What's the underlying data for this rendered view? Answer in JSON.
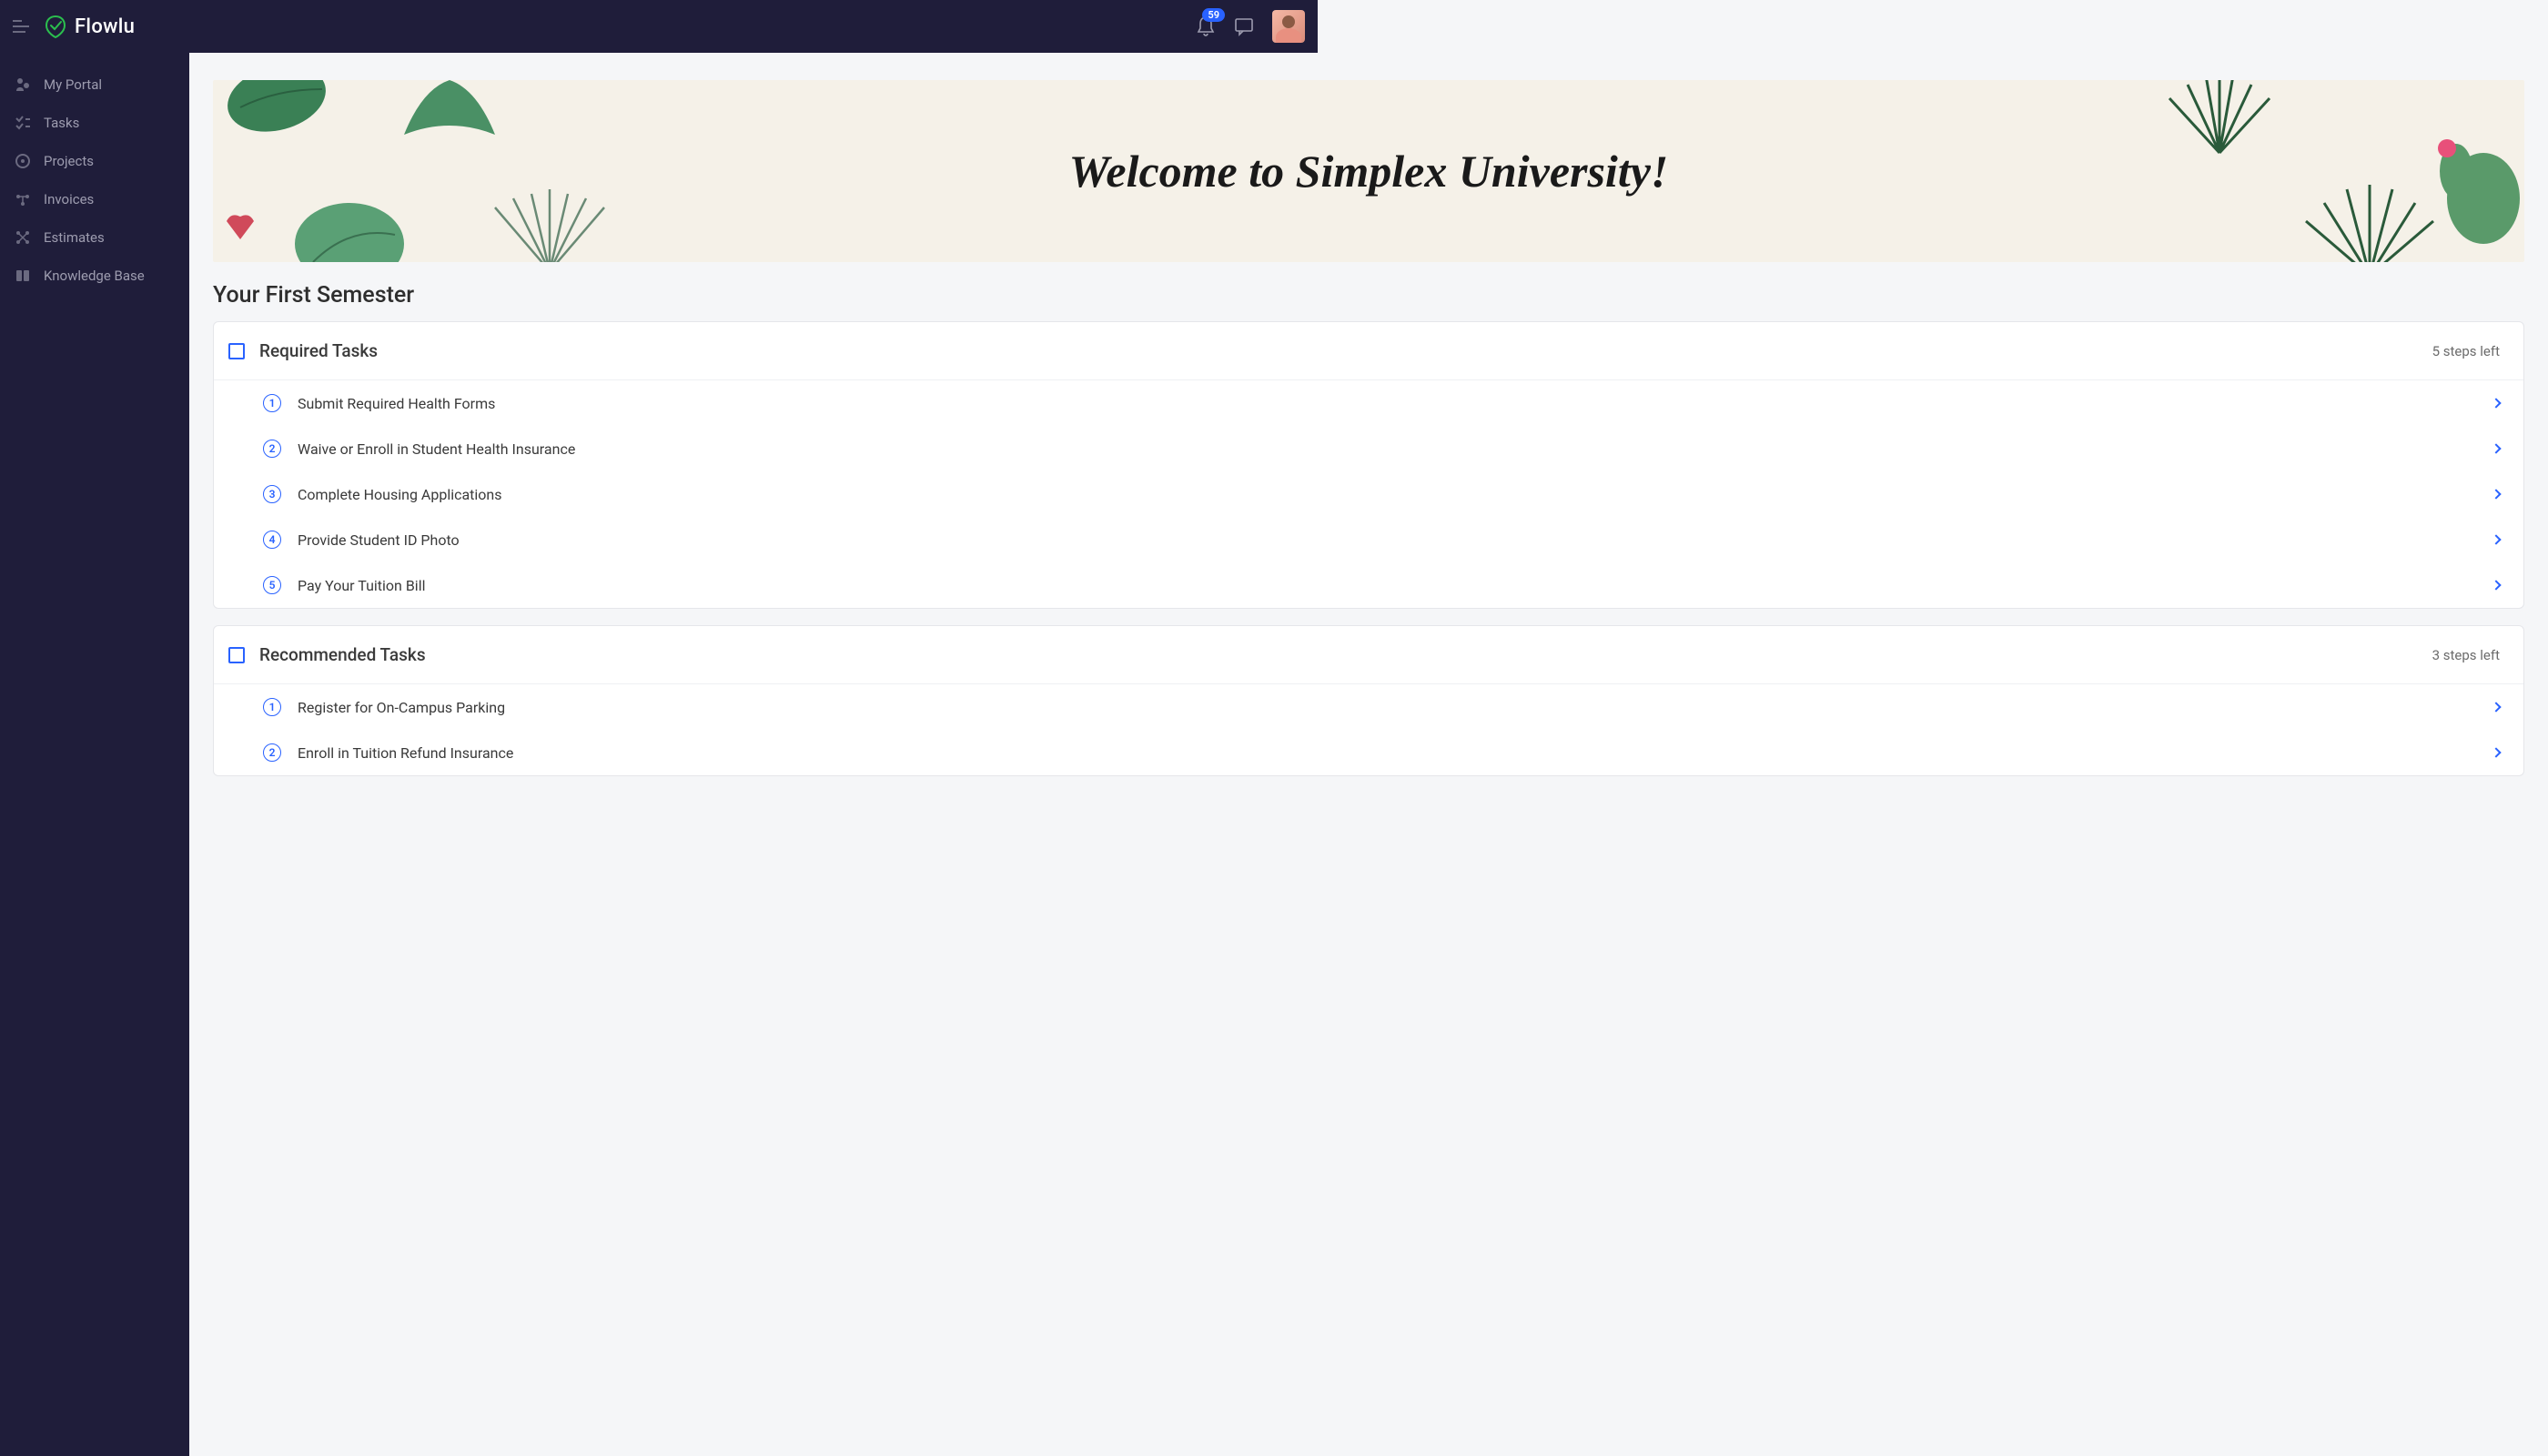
{
  "header": {
    "brand": "Flowlu",
    "notification_count": "59"
  },
  "sidebar": {
    "items": [
      {
        "label": "My Portal"
      },
      {
        "label": "Tasks"
      },
      {
        "label": "Projects"
      },
      {
        "label": "Invoices"
      },
      {
        "label": "Estimates"
      },
      {
        "label": "Knowledge Base"
      }
    ]
  },
  "banner": {
    "title": "Welcome to Simplex University!"
  },
  "section": {
    "title": "Your First Semester"
  },
  "cards": [
    {
      "title": "Required Tasks",
      "steps_left": "5 steps left",
      "tasks": [
        {
          "num": "1",
          "label": "Submit Required Health Forms"
        },
        {
          "num": "2",
          "label": "Waive or Enroll in Student Health Insurance"
        },
        {
          "num": "3",
          "label": "Complete Housing Applications"
        },
        {
          "num": "4",
          "label": "Provide Student ID Photo"
        },
        {
          "num": "5",
          "label": "Pay Your Tuition Bill"
        }
      ]
    },
    {
      "title": "Recommended Tasks",
      "steps_left": "3 steps left",
      "tasks": [
        {
          "num": "1",
          "label": "Register for On-Campus Parking"
        },
        {
          "num": "2",
          "label": "Enroll in Tuition Refund Insurance"
        }
      ]
    }
  ]
}
